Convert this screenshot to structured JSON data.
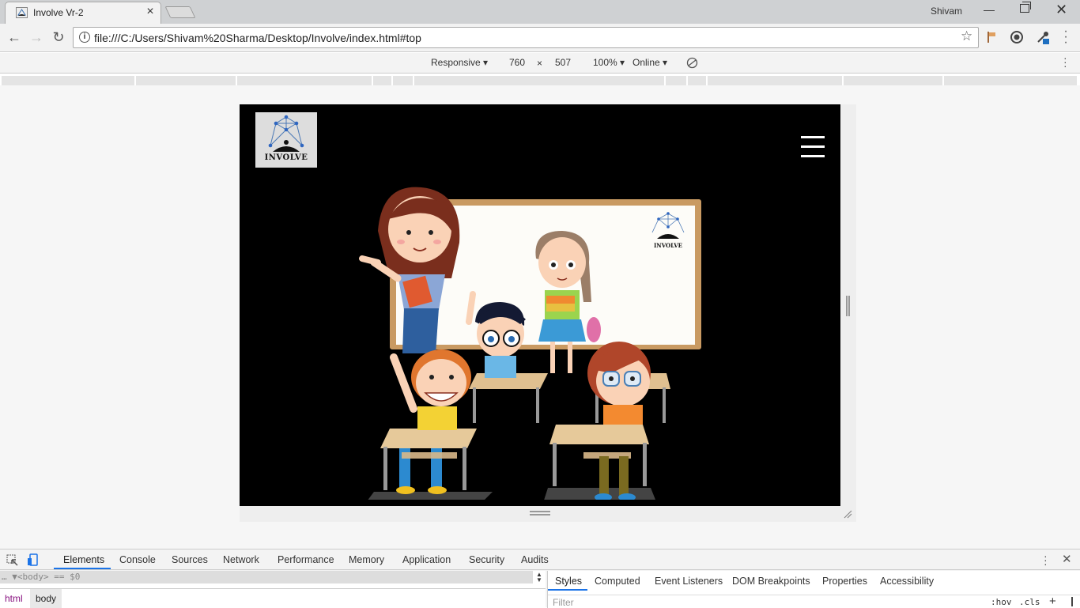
{
  "browser": {
    "tab_title": "Involve Vr-2",
    "tab_close": "×",
    "profile_name": "Shivam",
    "url": "file:///C:/Users/Shivam%20Sharma/Desktop/Involve/index.html#top"
  },
  "device_toolbar": {
    "mode": "Responsive",
    "width": "760",
    "times": "×",
    "height": "507",
    "zoom": "100%",
    "network": "Online"
  },
  "page": {
    "logo_text": "INVOLVE",
    "board_logo_text": "INVOLVE"
  },
  "devtools": {
    "tabs": [
      "Elements",
      "Console",
      "Sources",
      "Network",
      "Performance",
      "Memory",
      "Application",
      "Security",
      "Audits"
    ],
    "dom_line": "… ▼<body> == $0",
    "breadcrumbs": [
      "html",
      "body"
    ],
    "styles_tabs": [
      "Styles",
      "Computed",
      "Event Listeners",
      "DOM Breakpoints",
      "Properties",
      "Accessibility"
    ],
    "filter_placeholder": "Filter",
    "hov": ":hov",
    "cls": ".cls",
    "plus": "+"
  },
  "colors": {
    "accent": "#1a73e8",
    "page_bg": "#000000"
  }
}
